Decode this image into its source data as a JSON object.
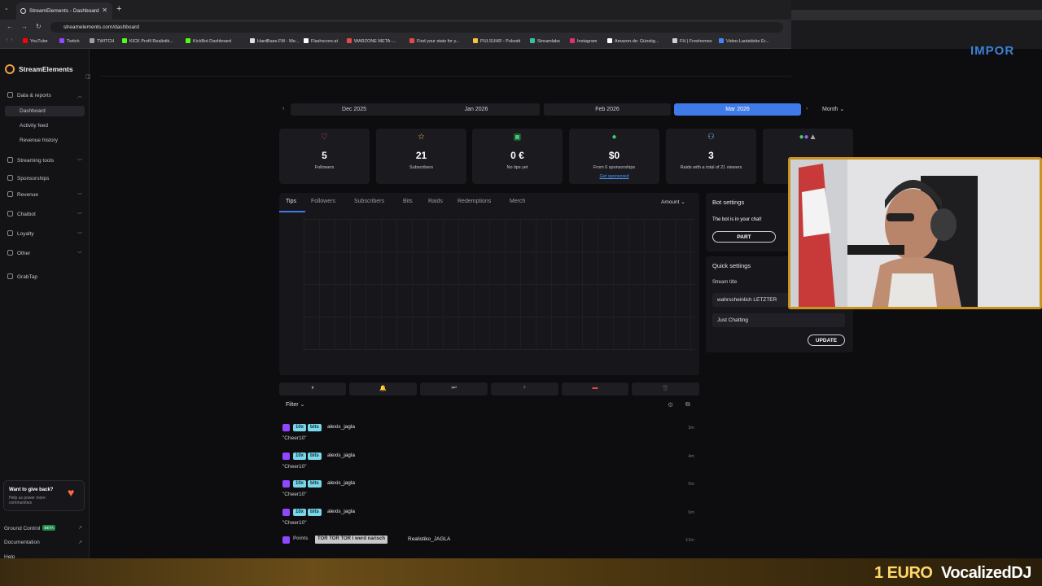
{
  "browser": {
    "tab_title": "StreamElements - Dashboard",
    "url": "streamelements.com/dashboard",
    "bookmarks": [
      {
        "label": "YouTube",
        "color": "#ff0000"
      },
      {
        "label": "Twitch",
        "color": "#9146ff"
      },
      {
        "label": "TWITCH",
        "color": "#9aa0a6"
      },
      {
        "label": "KICK Profil Realistik...",
        "color": "#53fc18"
      },
      {
        "label": "KickBot Dashboard",
        "color": "#53fc18"
      },
      {
        "label": "HardBase.FM - We...",
        "color": "#e0e0e0"
      },
      {
        "label": "Flashscore.at",
        "color": "#ffffff"
      },
      {
        "label": "WARZONE META -...",
        "color": "#e34a4a"
      },
      {
        "label": "Find your stats for y...",
        "color": "#e34a4a"
      },
      {
        "label": "PULSUHR - Pulsoid",
        "color": "#f5c542"
      },
      {
        "label": "Streamlabs",
        "color": "#31c3a2"
      },
      {
        "label": "Instagram",
        "color": "#e1306c"
      },
      {
        "label": "Amazon.de: Günstig...",
        "color": "#ffffff"
      },
      {
        "label": "FH | Freehomes",
        "color": "#cfd0d6"
      },
      {
        "label": "Video-Lautstärke Er...",
        "color": "#4285f4"
      }
    ]
  },
  "overlay": {
    "import_text": "IMPOR",
    "donation_amount": "1 EURO",
    "donor_name": "VocalizedDJ"
  },
  "sidebar": {
    "brand": "StreamElements",
    "sections": [
      {
        "label": "Data & reports",
        "expanded": true
      },
      {
        "label": "Streaming tools"
      },
      {
        "label": "Sponsorships"
      },
      {
        "label": "Revenue"
      },
      {
        "label": "Chatbot"
      },
      {
        "label": "Loyalty"
      },
      {
        "label": "Other"
      },
      {
        "label": "GrabTap"
      }
    ],
    "subitems": [
      "Dashboard",
      "Activity feed",
      "Revenue history"
    ],
    "give_back": {
      "title": "Want to give back?",
      "subtitle": "Help us power more communities"
    },
    "footer": {
      "ground_control": "Ground Control",
      "beta": "BETA",
      "documentation": "Documentation",
      "help": "Help"
    }
  },
  "months": {
    "items": [
      "Dec 2025",
      "Jan 2026",
      "Feb 2026",
      "Mar 2026"
    ],
    "active": "Mar 2026",
    "period": "Month"
  },
  "stats": [
    {
      "value": "5",
      "label": "Followers",
      "icon": "heart-icon",
      "color": "#ff5a7a"
    },
    {
      "value": "21",
      "label": "Subscribers",
      "icon": "star-icon",
      "color": "#f5c542"
    },
    {
      "value": "0 €",
      "label": "No tips yet",
      "icon": "cash-icon",
      "color": "#3ecf6f"
    },
    {
      "value": "$0",
      "label": "From 0 sponsorships",
      "link": "Get sponsored",
      "icon": "dollar-icon",
      "color": "#3ecf6f"
    },
    {
      "value": "3",
      "label": "Raids with a total of 21 viewers",
      "icon": "raid-icon",
      "color": "#8fb3ff"
    }
  ],
  "chart_tabs": {
    "items": [
      "Tips",
      "Followers",
      "Subscribers",
      "Bits",
      "Raids",
      "Redemptions",
      "Merch"
    ],
    "active": "Tips",
    "metric": "Amount"
  },
  "feed": {
    "filter": "Filter",
    "events": [
      {
        "amount": "10x",
        "kind": "bits",
        "user": "alexis_jagla",
        "message": "\"Cheer10\"",
        "age": "3m"
      },
      {
        "amount": "10x",
        "kind": "bits",
        "user": "alexis_jagla",
        "message": "\"Cheer10\"",
        "age": "4m"
      },
      {
        "amount": "10x",
        "kind": "bits",
        "user": "alexis_jagla",
        "message": "\"Cheer10\"",
        "age": "5m"
      },
      {
        "amount": "10x",
        "kind": "bits",
        "user": "alexis_jagla",
        "message": "\"Cheer10\"",
        "age": "6m"
      }
    ],
    "points_event": {
      "kind": "Points",
      "message": "TOR TOR TOR I werd narisch",
      "user": "Realistiko_JAGLA",
      "age": "12m"
    }
  },
  "bot": {
    "title": "Bot settings",
    "status": "The bot is in your chat!",
    "part_button": "PART"
  },
  "quick_settings": {
    "title": "Quick settings",
    "stream_title_label": "Stream title",
    "stream_title_value": "wahrscheinlich LETZTER",
    "category": "Just Chatting",
    "update_button": "UPDATE"
  }
}
